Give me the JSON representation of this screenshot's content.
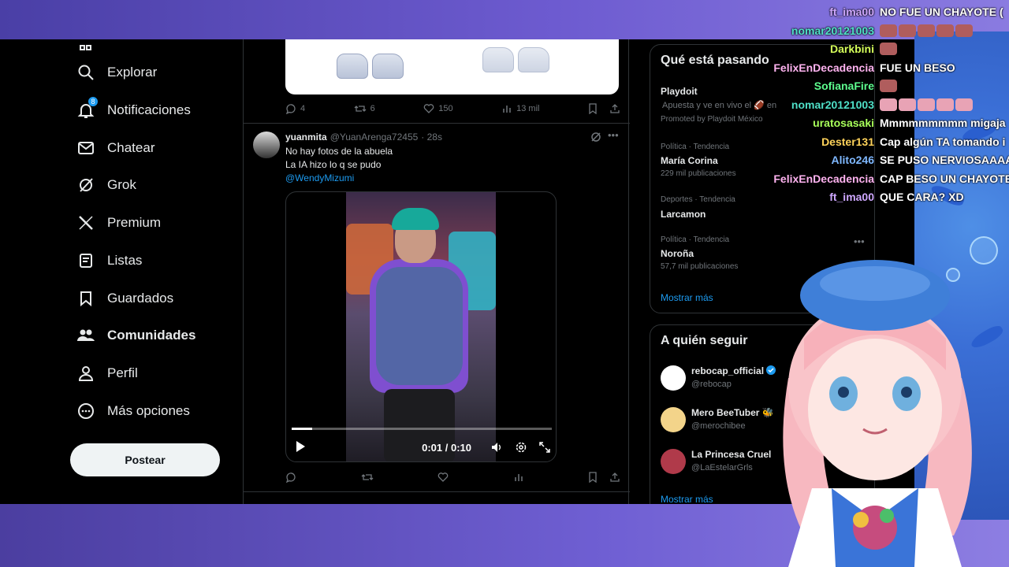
{
  "nav": {
    "items": [
      {
        "label": "Explorar",
        "icon": "search-icon"
      },
      {
        "label": "Notificaciones",
        "icon": "bell-icon",
        "badge": "8"
      },
      {
        "label": "Chatear",
        "icon": "mail-icon"
      },
      {
        "label": "Grok",
        "icon": "grok-icon"
      },
      {
        "label": "Premium",
        "icon": "x-logo-icon"
      },
      {
        "label": "Listas",
        "icon": "list-icon"
      },
      {
        "label": "Guardados",
        "icon": "bookmark-icon"
      },
      {
        "label": "Comunidades",
        "icon": "communities-icon"
      },
      {
        "label": "Perfil",
        "icon": "person-icon"
      },
      {
        "label": "Más opciones",
        "icon": "more-icon"
      }
    ],
    "post_button": "Postear"
  },
  "feed": {
    "prev_post": {
      "replies": "4",
      "reposts": "6",
      "likes": "150",
      "views": "13 mil"
    },
    "tweet": {
      "name": "yuanmita",
      "handle": "@YuanArenga72455",
      "time": "· 28s",
      "line1": "No hay fotos de la abuela",
      "line2": "La IA hizo lo q se pudo",
      "mention": "@WendyMizumi",
      "video_time": "0:01 / 0:10",
      "video_progress_pct": 8
    }
  },
  "sidebar": {
    "trending_title": "Qué está pasando",
    "promo": {
      "name": "Playdoit",
      "text": "Apuesta y ve en vivo el 🏈 en",
      "promoted": "Promoted by Playdoit México"
    },
    "trends": [
      {
        "meta": "Política · Tendencia",
        "name": "María Corina",
        "count": "229 mil publicaciones"
      },
      {
        "meta": "Deportes · Tendencia",
        "name": "Larcamon",
        "count": ""
      },
      {
        "meta": "Política · Tendencia",
        "name": "Noroña",
        "count": "57,7 mil publicaciones"
      }
    ],
    "show_more": "Mostrar más",
    "follow_title": "A quién seguir",
    "follows": [
      {
        "name": "rebocap_official",
        "handle": "@rebocap",
        "color": "#ffffff"
      },
      {
        "name": "Mero BeeTuber 🐝",
        "handle": "@merochibee",
        "color": "#f3d48a"
      },
      {
        "name": "La Princesa Cruel",
        "handle": "@LaEstelarGrls",
        "color": "#b03a4a"
      }
    ],
    "follow_more": "Mostrar más"
  },
  "chat": [
    {
      "user": "ft_ima00",
      "color": "#cfa8ff",
      "msg": "NO FUE UN CHAYOTE ( ",
      "emotes": 0
    },
    {
      "user": "nomar20121003",
      "color": "#4fe0c8",
      "msg": "",
      "emotes": 5
    },
    {
      "user": "Darkbini",
      "color": "#d5ff5a",
      "msg": "",
      "emotes": 1
    },
    {
      "user": "FelixEnDecadencia",
      "color": "#ffb3f0",
      "msg": "FUE UN BESO",
      "emotes": 0
    },
    {
      "user": "SofianaFire",
      "color": "#5dff8f",
      "msg": "",
      "emotes": 1
    },
    {
      "user": "nomar20121003",
      "color": "#4fe0c8",
      "msg": "",
      "emotes": 5,
      "pink": true
    },
    {
      "user": "uratosasaki",
      "color": "#a8ff5a",
      "msg": "Mmmmmmmmm migaja",
      "emotes": 0
    },
    {
      "user": "Dester131",
      "color": "#ffd35a",
      "msg": "Cap algún TA tomando i",
      "emotes": 0
    },
    {
      "user": "Alito246",
      "color": "#7fb8ff",
      "msg": "SE PUSO NERVIOSAAAA",
      "emotes": 0
    },
    {
      "user": "FelixEnDecadencia",
      "color": "#ffb3f0",
      "msg": "CAP BESO UN CHAYOTE",
      "emotes": 0
    },
    {
      "user": "ft_ima00",
      "color": "#cfa8ff",
      "msg": "QUE CARA? XD",
      "emotes": 0
    }
  ]
}
